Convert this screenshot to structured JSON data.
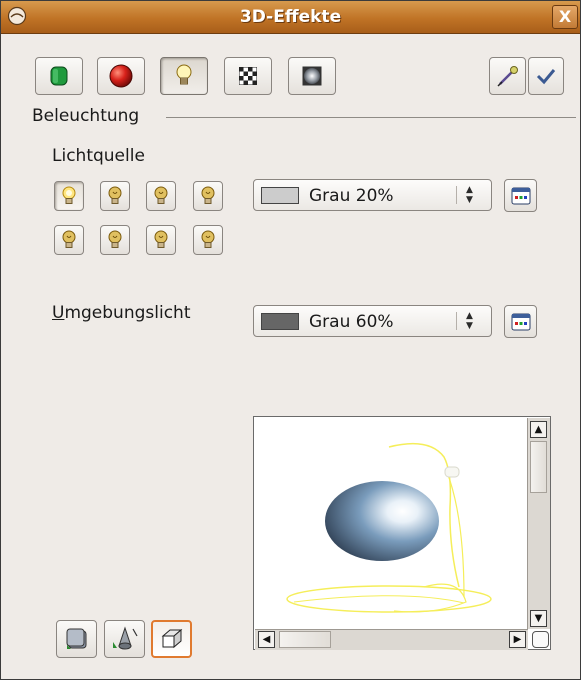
{
  "window": {
    "title": "3D-Effekte",
    "close_label": "X"
  },
  "toolbar": {
    "buttons": [
      {
        "name": "geometry",
        "icon": "green-cylinder-icon",
        "active": false
      },
      {
        "name": "shading",
        "icon": "red-sphere-icon",
        "active": false
      },
      {
        "name": "illumination",
        "icon": "light-bulb-icon",
        "active": true
      },
      {
        "name": "textures",
        "icon": "checker-texture-icon",
        "active": false
      },
      {
        "name": "material",
        "icon": "gray-sphere-material-icon",
        "active": false
      }
    ],
    "right_buttons": [
      {
        "name": "assign",
        "icon": "pipette-icon"
      },
      {
        "name": "update",
        "icon": "checkmark-icon"
      }
    ]
  },
  "illumination": {
    "section_label": "Beleuchtung",
    "light_source_label": "Lichtquelle",
    "light_source_color": {
      "value": "Grau 20%",
      "swatch": "#cccccc"
    },
    "ambient_label_underlined_char": "U",
    "ambient_label_rest": "mgebungslicht",
    "ambient_color": {
      "value": "Grau 60%",
      "swatch": "#666666"
    }
  },
  "colors": {
    "titlebar": "#c07326",
    "bulb_on": "#ffe680",
    "bulb_off": "#b08a20",
    "active_border": "#e07a2f"
  },
  "preview": {
    "sphere_color": "#6d8fae",
    "light_ring_color": "#f5ee5a"
  },
  "bottom_buttons": [
    {
      "name": "convert-to-3d",
      "icon": "convert-3d-icon",
      "active": false
    },
    {
      "name": "convert-to-lathe",
      "icon": "lathe-object-icon",
      "active": false
    },
    {
      "name": "perspective",
      "icon": "perspective-cube-icon",
      "active": true
    }
  ]
}
